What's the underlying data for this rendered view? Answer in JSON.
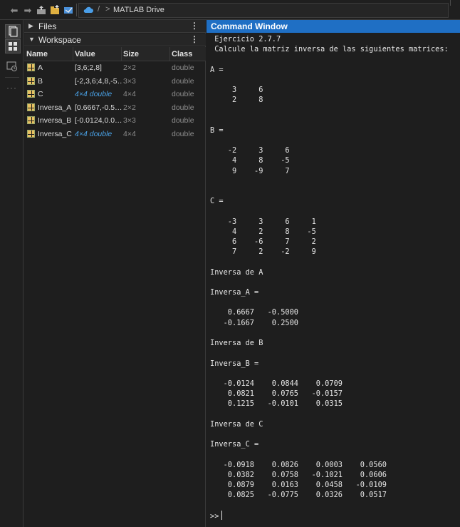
{
  "toolbar": {
    "back_icon": "back-arrow-icon",
    "forward_icon": "forward-arrow-icon",
    "up_icon": "up-folder-icon",
    "browse_icon": "browse-folder-icon",
    "sep1": "/",
    "sep2": ">",
    "location": "MATLAB Drive"
  },
  "files": {
    "title": "Files",
    "menu": "⋮"
  },
  "workspace": {
    "title": "Workspace",
    "menu": "⋮",
    "columns": [
      "Name",
      "Value",
      "Size",
      "Class"
    ],
    "rows": [
      {
        "name": "A",
        "value": "[3,6;2,8]",
        "size": "2×2",
        "class": "double",
        "italic": false
      },
      {
        "name": "B",
        "value": "[-2,3,6;4,8,-5…",
        "size": "3×3",
        "class": "double",
        "italic": false
      },
      {
        "name": "C",
        "value": "4×4 double",
        "size": "4×4",
        "class": "double",
        "italic": true
      },
      {
        "name": "Inversa_A",
        "value": "[0.6667,-0.5…",
        "size": "2×2",
        "class": "double",
        "italic": false
      },
      {
        "name": "Inversa_B",
        "value": "[-0.0124,0.0…",
        "size": "3×3",
        "class": "double",
        "italic": false
      },
      {
        "name": "Inversa_C",
        "value": "4×4 double",
        "size": "4×4",
        "class": "double",
        "italic": true
      }
    ]
  },
  "command_window": {
    "title": "Command Window",
    "output": " Ejercicio 2.7.7\n Calcule la matriz inversa de las siguientes matrices:\n\nA =\n\n     3     6\n     2     8\n\n\nB =\n\n    -2     3     6\n     4     8    -5\n     9    -9     7\n\n\nC =\n\n    -3     3     6     1\n     4     2     8    -5\n     6    -6     7     2\n     7     2    -2     9\n\nInversa de A\n\nInversa_A =\n\n    0.6667   -0.5000\n   -0.1667    0.2500\n\nInversa de B\n\nInversa_B =\n\n   -0.0124    0.0844    0.0709\n    0.0821    0.0765   -0.0157\n    0.1215   -0.0101    0.0315\n\nInversa de C\n\nInversa_C =\n\n   -0.0918    0.0826    0.0003    0.0560\n    0.0382    0.0758   -0.1021    0.0606\n    0.0879    0.0163    0.0458   -0.0109\n    0.0825   -0.0775    0.0326    0.0517",
    "prompt": ">>"
  }
}
